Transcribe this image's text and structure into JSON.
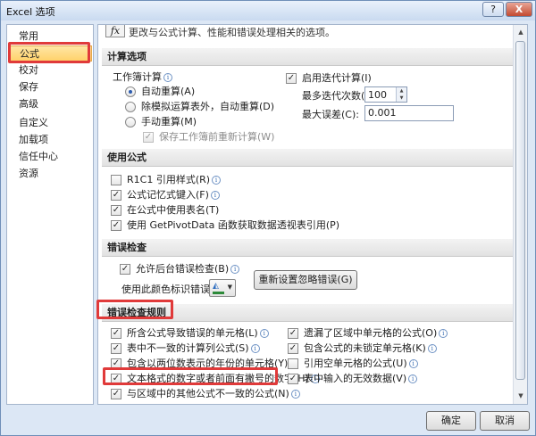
{
  "window": {
    "title": "Excel 选项",
    "help_label": "?",
    "close_label": "X"
  },
  "sidebar": {
    "items": [
      {
        "label": "常用"
      },
      {
        "label": "公式"
      },
      {
        "label": "校对"
      },
      {
        "label": "保存"
      },
      {
        "label": "高级"
      },
      {
        "label": "自定义"
      },
      {
        "label": "加载项"
      },
      {
        "label": "信任中心"
      },
      {
        "label": "资源"
      }
    ],
    "selected": "公式"
  },
  "intro": {
    "icon": "function-fx-icon",
    "icon_text": "fx",
    "text": "更改与公式计算、性能和错误处理相关的选项。"
  },
  "calculation": {
    "header": "计算选项",
    "workbook_label": "工作簿计算",
    "auto": "自动重算(A)",
    "auto_except": "除模拟运算表外，自动重算(D)",
    "manual": "手动重算(M)",
    "recalc_before_save": "保存工作簿前重新计算(W)",
    "iterative": "启用迭代计算(I)",
    "max_iterations_label": "最多迭代次数(X):",
    "max_iterations": "100",
    "max_change_label": "最大误差(C):",
    "max_change": "0.001"
  },
  "formulas": {
    "header": "使用公式",
    "r1c1": "R1C1 引用样式(R)",
    "autocomplete": "公式记忆式键入(F)",
    "table_names": "在公式中使用表名(T)",
    "getpivotdata": "使用 GetPivotData 函数获取数据透视表引用(P)"
  },
  "error_checking": {
    "header": "错误检查",
    "background": "允许后台错误检查(B)",
    "color_label": "使用此颜色标识错误(E):",
    "color": "#2d8a3a",
    "reset_button": "重新设置忽略错误(G)"
  },
  "error_rules": {
    "header": "错误检查规则",
    "left": [
      "所含公式导致错误的单元格(L)",
      "表中不一致的计算列公式(S)",
      "包含以两位数表示的年份的单元格(Y)",
      "文本格式的数字或者前面有撇号的数字(H)",
      "与区域中的其他公式不一致的公式(N)"
    ],
    "right": [
      "遗漏了区域中单元格的公式(O)",
      "包含公式的未锁定单元格(K)",
      "引用空单元格的公式(U)",
      "表中输入的无效数据(V)"
    ]
  },
  "footer": {
    "ok": "确定",
    "cancel": "取消"
  },
  "colors": {
    "highlight": "#e03a3a",
    "selected_nav": "#ffd26b"
  }
}
